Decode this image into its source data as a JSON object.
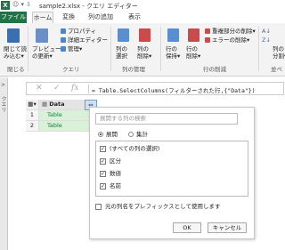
{
  "titlebar": {
    "app_icon": "X",
    "quick_access": "☺ ▾ ⇩",
    "title": "sample2.xlsx - クエリ エディター"
  },
  "tabs": [
    "ファイル",
    "ホーム",
    "変換",
    "列の追加",
    "表示"
  ],
  "ribbon": {
    "close_load": [
      "閉じて読",
      "み込む▾"
    ],
    "preview": [
      "プレビュー",
      "の更新▾"
    ],
    "properties": "プロパティ",
    "advanced_editor": "詳細エディター",
    "manage": "管理▾",
    "choose_cols": [
      "列の",
      "選択"
    ],
    "remove_cols": [
      "列の",
      "削除▾"
    ],
    "keep_rows": [
      "行の",
      "保持▾"
    ],
    "remove_rows": [
      "行の",
      "削除▾"
    ],
    "remove_dup": "重複部分の削除▾",
    "remove_err": "エラーの削除▾",
    "sort_asc": "A↓",
    "sort_desc": "Z↓",
    "split": [
      "列の",
      "分割▾"
    ],
    "groups": {
      "close": "閉じる",
      "query": "クエリ",
      "manage_cols": "列の管理",
      "reduce_rows": "行の削減",
      "all": "並べ"
    }
  },
  "sidebar": {
    "arrow": ">",
    "label": "クエリ"
  },
  "formula": {
    "cancel": "✕",
    "ok": "✓",
    "fx": "fx",
    "text": "= Table.SelectColumns(フィルターされた行,{\"Data\"})"
  },
  "grid": {
    "header": "Data",
    "rows": [
      {
        "n": "1",
        "v": "Table"
      },
      {
        "n": "2",
        "v": "Table"
      }
    ]
  },
  "popup": {
    "search_placeholder": "展開する列の検索",
    "radio_expand": "展開",
    "radio_aggregate": "集計",
    "items": [
      "(すべての列の選択)",
      "区分",
      "数値",
      "名前"
    ],
    "prefix_label": "元の列名をプレフィックスとして使用します",
    "ok": "OK",
    "cancel": "キャンセル"
  }
}
